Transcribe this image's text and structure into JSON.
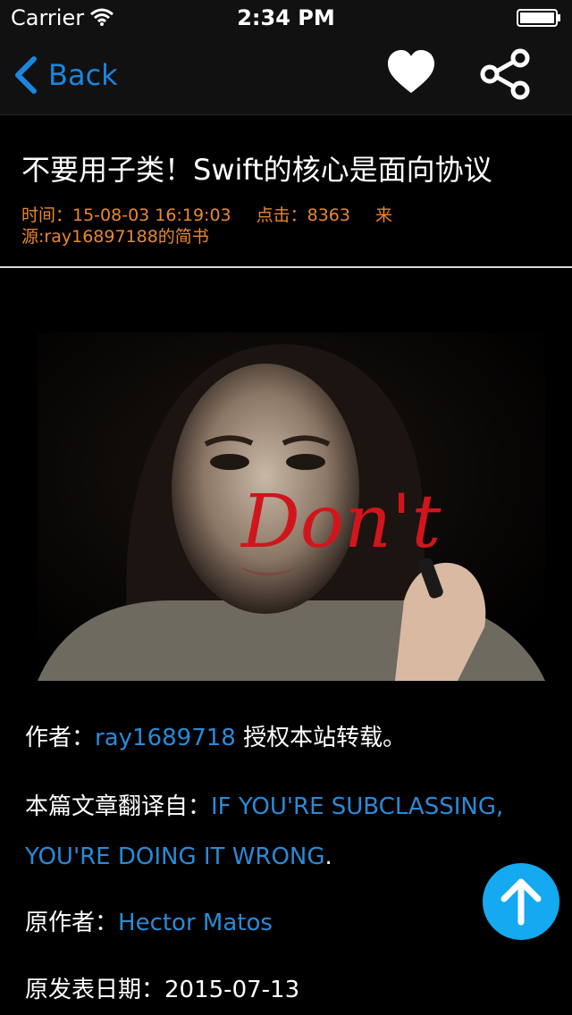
{
  "status_bar": {
    "carrier": "Carrier",
    "time": "2:34 PM"
  },
  "nav": {
    "back_label": "Back"
  },
  "article": {
    "title": "不要用子类！Swift的核心是面向协议",
    "meta": {
      "time": "时间：15-08-03 16:19:03",
      "clicks": "点击：8363",
      "source": "来源:ray16897188的简书"
    },
    "image_text": "Don't",
    "author_prefix": "作者：",
    "author_link": "ray1689718",
    "author_suffix": " 授权本站转载。",
    "translated_prefix": "本篇文章翻译自：",
    "translated_link": "IF YOU'RE SUBCLASSING, YOU'RE DOING IT WRONG",
    "translated_suffix": ".",
    "orig_author_prefix": "原作者：",
    "orig_author_link": "Hector Matos",
    "pub_date_label": "原发表日期：",
    "pub_date": "2015-07-13"
  },
  "colors": {
    "accent": "#1a86e0",
    "link": "#2a8ad6",
    "meta": "#e8882e",
    "fab": "#14a9f0"
  },
  "icons": [
    "wifi-icon",
    "battery-icon",
    "back-chevron-icon",
    "heart-icon",
    "share-icon",
    "arrow-up-icon"
  ]
}
